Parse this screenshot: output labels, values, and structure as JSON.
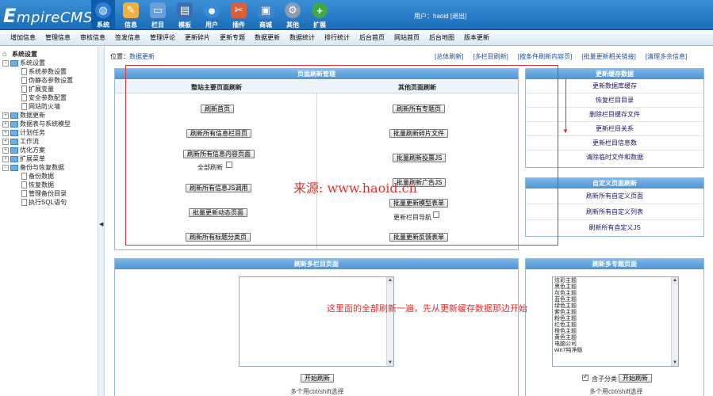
{
  "header": {
    "logo_prefix": "E",
    "logo_text": "mpireCMS",
    "nav": [
      {
        "label": "系统",
        "icon": "globe-icon",
        "color": "#2f7ed8"
      },
      {
        "label": "信息",
        "icon": "edit-icon",
        "color": "#e8a23a"
      },
      {
        "label": "栏目",
        "icon": "folder-icon",
        "color": "#5a8fd0"
      },
      {
        "label": "模板",
        "icon": "template-icon",
        "color": "#3d6fb0"
      },
      {
        "label": "用户",
        "icon": "user-icon",
        "color": "#3a8ad6"
      },
      {
        "label": "插件",
        "icon": "tools-icon",
        "color": "#d9603b"
      },
      {
        "label": "商城",
        "icon": "shop-icon",
        "color": "#3f86c9"
      },
      {
        "label": "其他",
        "icon": "gear-icon",
        "color": "#8b9bb0"
      },
      {
        "label": "扩展",
        "icon": "plus-icon",
        "color": "#3fa84a"
      }
    ],
    "user_label": "用户：haoid",
    "logout_label": "[退出]"
  },
  "subnav": [
    "增加信息",
    "管理信息",
    "审核信息",
    "签发信息",
    "管理评论",
    "更新碎片",
    "更新专题",
    "数据更新",
    "数据统计",
    "排行统计",
    "后台首页",
    "网站首页",
    "后台地图",
    "版本更新"
  ],
  "tree": {
    "root": "系统设置",
    "items": [
      {
        "label": "系统设置",
        "level": 1,
        "type": "folder-open"
      },
      {
        "label": "系统参数设置",
        "level": 2,
        "type": "doc"
      },
      {
        "label": "伪静态参数设置",
        "level": 2,
        "type": "doc"
      },
      {
        "label": "扩展变量",
        "level": 2,
        "type": "doc"
      },
      {
        "label": "安全参数配置",
        "level": 2,
        "type": "doc"
      },
      {
        "label": "网站防火墙",
        "level": 2,
        "type": "doc"
      },
      {
        "label": "数据更新",
        "level": 1,
        "type": "folder"
      },
      {
        "label": "数据表与系统模型",
        "level": 1,
        "type": "folder"
      },
      {
        "label": "计划任务",
        "level": 1,
        "type": "folder"
      },
      {
        "label": "工作流",
        "level": 1,
        "type": "folder"
      },
      {
        "label": "优化方案",
        "level": 1,
        "type": "folder"
      },
      {
        "label": "扩展菜单",
        "level": 1,
        "type": "folder"
      },
      {
        "label": "备份与恢复数据",
        "level": 1,
        "type": "folder-open"
      },
      {
        "label": "备份数据",
        "level": 2,
        "type": "doc"
      },
      {
        "label": "恢复数据",
        "level": 2,
        "type": "doc"
      },
      {
        "label": "管理备份目录",
        "level": 2,
        "type": "doc"
      },
      {
        "label": "执行SQL语句",
        "level": 2,
        "type": "doc"
      }
    ]
  },
  "crumb": {
    "prefix": "位置：",
    "link": "数据更新"
  },
  "quick_links": [
    "[总体刷新]",
    "[多栏目刷新]",
    "[按条件刷新内容页]",
    "[批量更新相关链接]",
    "[清理多余信息]"
  ],
  "refresh_panel": {
    "title": "页面刷新管理",
    "left_head": "整站主要页面刷新",
    "right_head": "其他页面刷新",
    "left_buttons": [
      "刷新首页",
      "刷新所有信息栏目页",
      "刷新所有信息内容页面",
      "刷新所有信息JS调用",
      "批量更新动态页面",
      "刷新所有标题分类页"
    ],
    "full_refresh_label": "全部刷新",
    "right_buttons": [
      "刷新所有专题页",
      "批量刷新碎片文件",
      "批量刷新投票JS",
      "批量刷新广告JS",
      "批量更新模型表单",
      "批量更新反馈表单"
    ],
    "nav_update_label": "更新栏目导航"
  },
  "cache_panel": {
    "title": "更新缓存数据",
    "links": [
      "更新数据库缓存",
      "恢复栏目目录",
      "删除栏目缓存文件",
      "更新栏目关系",
      "更新栏目信息数",
      "清除临时文件和数据"
    ]
  },
  "custom_panel": {
    "title": "自定义页面刷新",
    "links": [
      "刷新所有自定义页面",
      "刷新所有自定义列表",
      "刷新所有自定义JS"
    ]
  },
  "multi_panel": {
    "title": "刷新多栏目页面",
    "start_button": "开始刷新",
    "hint": "多个用ctrl/shift选择"
  },
  "topic_panel": {
    "title": "刷新多专题页面",
    "topics": [
      "炫彩主题",
      "黑色主题",
      "灰色主题",
      "蓝色主题",
      "绿色主题",
      "紫色主题",
      "粉色主题",
      "红色主题",
      "橙色主题",
      "黄色主题",
      "电脑公司",
      "win7纯净版"
    ],
    "include_sub_label": "含子分类",
    "start_button": "开始刷新",
    "hint": "多个用ctrl/shift选择"
  },
  "annotations": {
    "watermark": "来源: www.haoid.cn",
    "note": "这里面的全部刷新一遍，先从更新缓存数据那边开始",
    "color": "#e03030"
  }
}
